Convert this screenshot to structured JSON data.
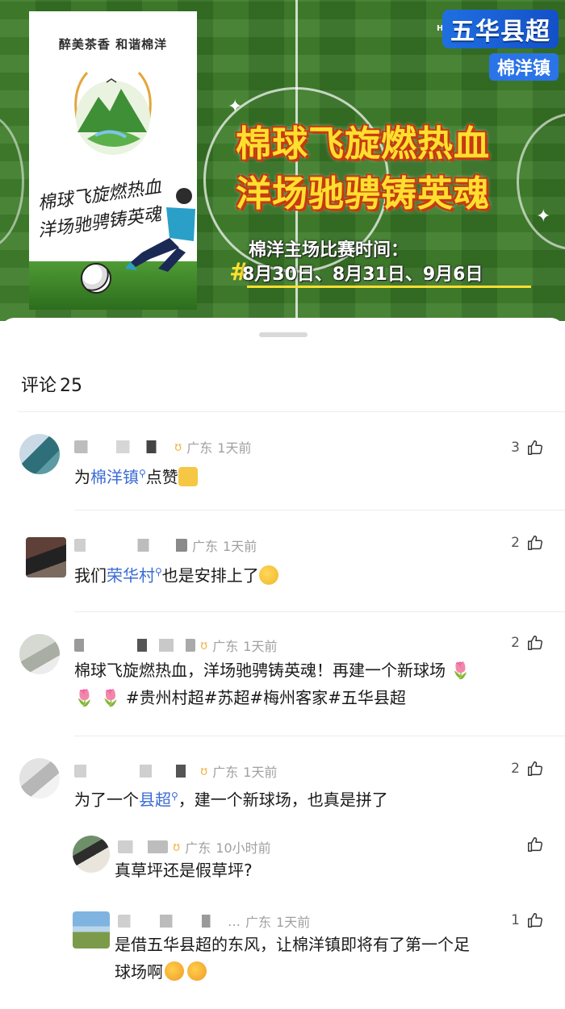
{
  "banner": {
    "poster_slogan": "醉美茶香 和谐棉洋",
    "poster_line1": "棉球飞旋燃热血",
    "poster_line2": "洋场驰骋铸英魂",
    "logo_main": "五华县超",
    "logo_sub": "棉洋镇",
    "hd_badge": "HD",
    "title_line1": "棉球飞旋燃热血",
    "title_line2": "洋场驰骋铸英魂",
    "schedule_label": "棉洋主场比赛时间：",
    "schedule_dates": "8月30日、8月31日、9月6日",
    "hash": "#"
  },
  "comments_header": {
    "label": "评论",
    "count": "25"
  },
  "colors": {
    "link": "#3a6bd6",
    "meta": "#a0a0a0",
    "title_yellow": "#ffdf2e",
    "title_outline": "#c53a10"
  },
  "comments": [
    {
      "location": "广东",
      "time": "1天前",
      "likes": "3",
      "text_pre": "为",
      "link": "棉洋镇",
      "text_post": "点赞",
      "emoji": "thumbs-up-emoji"
    },
    {
      "location": "广东",
      "time": "1天前",
      "likes": "2",
      "text_pre": "我们",
      "link": "荣华村",
      "text_post": "也是安排上了",
      "emoji": "thinking-face-emoji"
    },
    {
      "location": "广东",
      "time": "1天前",
      "likes": "2",
      "line1": "棉球飞旋燃热血，洋场驰骋铸英魂！再建一个新球场",
      "line2": "#贵州村超#苏超#梅州客家#五华县超",
      "emoji": "tulip-emoji"
    },
    {
      "location": "广东",
      "time": "1天前",
      "likes": "2",
      "text_pre": "为了一个",
      "link": "县超",
      "text_post": "，建一个新球场，也真是拼了",
      "replies": [
        {
          "location": "广东",
          "time": "10小时前",
          "likes": "",
          "text": "真草坪还是假草坪?"
        },
        {
          "location": "广东",
          "time": "1天前",
          "likes": "1",
          "name_suffix": "…",
          "line1": "是借五华县超的东风，让棉洋镇即将有了第一个足",
          "line2": "球场啊",
          "emoji": "hot-face-emoji"
        }
      ]
    }
  ]
}
